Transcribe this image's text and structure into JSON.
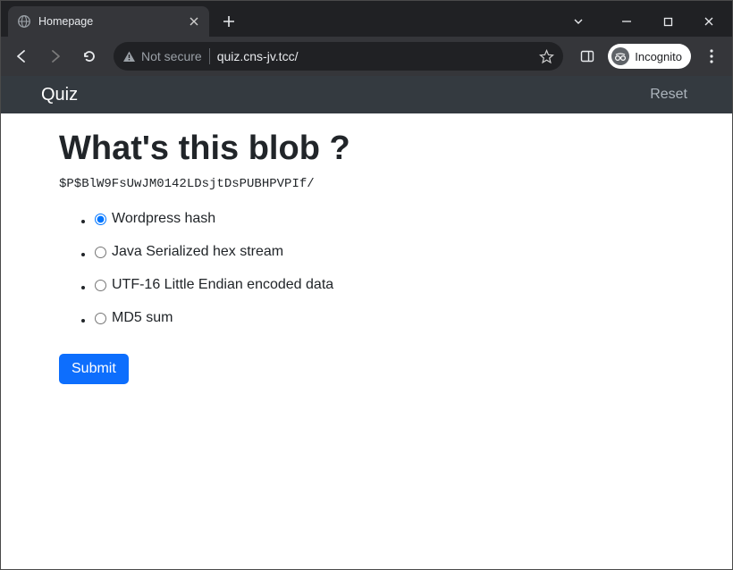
{
  "browser": {
    "tab_title": "Homepage",
    "not_secure_label": "Not secure",
    "url": "quiz.cns-jv.tcc/",
    "incognito_label": "Incognito"
  },
  "nav": {
    "brand": "Quiz",
    "reset": "Reset"
  },
  "quiz": {
    "heading": "What's this blob ?",
    "blob": "$P$BlW9FsUwJM0142LDsjtDsPUBHPVPIf/",
    "answers": [
      {
        "label": "Wordpress hash",
        "checked": true
      },
      {
        "label": "Java Serialized hex stream",
        "checked": false
      },
      {
        "label": "UTF-16 Little Endian encoded data",
        "checked": false
      },
      {
        "label": "MD5 sum",
        "checked": false
      }
    ],
    "submit_label": "Submit"
  }
}
